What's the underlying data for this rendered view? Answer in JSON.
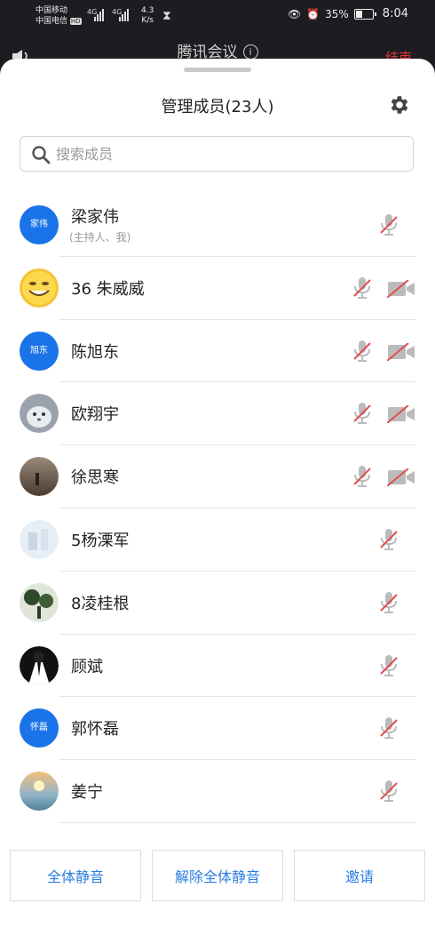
{
  "status_bar": {
    "carrier_1": "中国移动",
    "carrier_2": "中国电信",
    "hd": "HD",
    "net_1": "4G",
    "net_2": "4G",
    "speed_value": "4.3",
    "speed_unit": "K/s",
    "battery": "35%",
    "time": "8:04"
  },
  "background": {
    "app_title": "腾讯会议",
    "end_label": "结束"
  },
  "panel": {
    "title": "管理成员(23人)",
    "search_placeholder": "搜索成员"
  },
  "members": [
    {
      "name": "梁家伟",
      "sub": "(主持人、我)",
      "avatar_text": "家伟",
      "avatar_type": "text",
      "camera": false
    },
    {
      "name": "36 朱威威",
      "avatar_type": "emoji-face",
      "camera": true
    },
    {
      "name": "陈旭东",
      "avatar_text": "旭东",
      "avatar_type": "text",
      "camera": true
    },
    {
      "name": "欧翔宇",
      "avatar_type": "photo-cat",
      "camera": true
    },
    {
      "name": "徐思寒",
      "avatar_type": "photo-dusk",
      "camera": true
    },
    {
      "name": "5杨溧军",
      "avatar_type": "photo-light",
      "camera": false
    },
    {
      "name": "8凌桂根",
      "avatar_type": "photo-trees",
      "camera": false
    },
    {
      "name": "顾斌",
      "avatar_type": "photo-suit",
      "camera": false
    },
    {
      "name": "郭怀磊",
      "avatar_text": "怀磊",
      "avatar_type": "text",
      "camera": false
    },
    {
      "name": "姜宁",
      "avatar_type": "photo-sunset",
      "camera": false
    }
  ],
  "actions": {
    "mute_all": "全体静音",
    "unmute_all": "解除全体静音",
    "invite": "邀请"
  },
  "colors": {
    "accent": "#2b7de1",
    "avatar_blue": "#1a73e8",
    "muted_red": "#e05050",
    "end_red": "#e03535"
  }
}
